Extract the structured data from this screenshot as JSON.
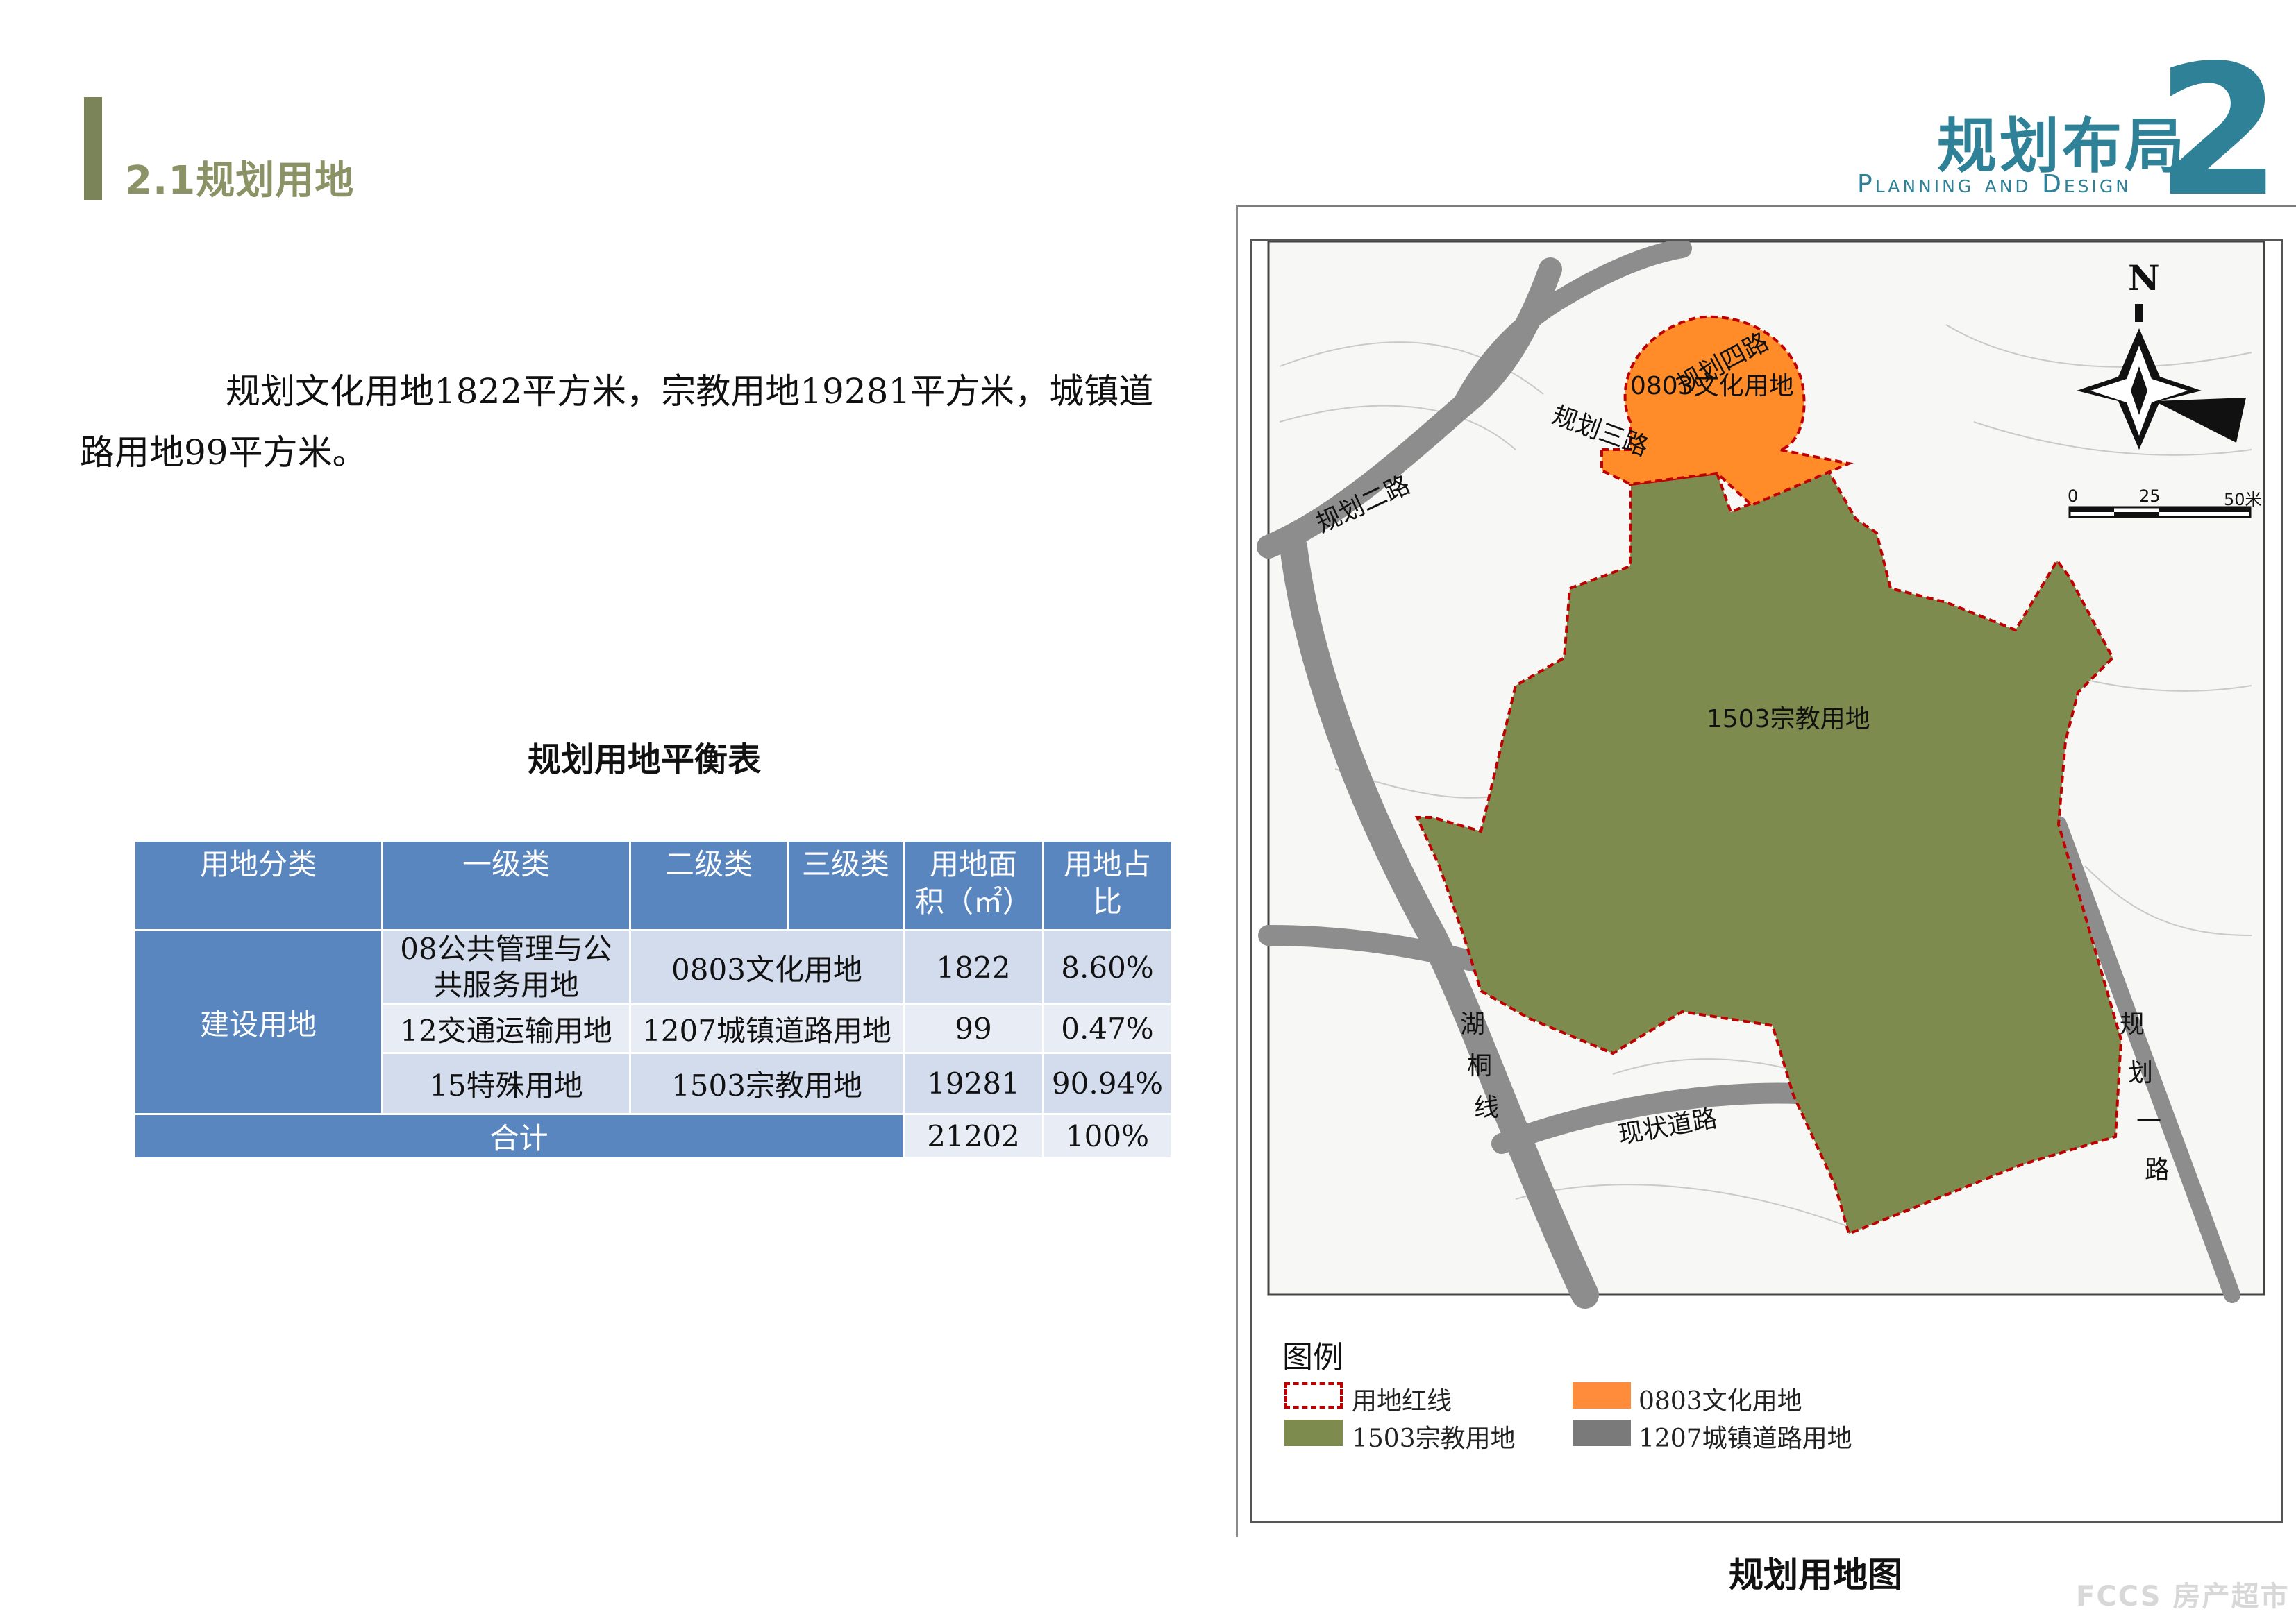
{
  "header": {
    "section_title": "2.1规划用地",
    "chapter_title": "规划布局",
    "chapter_subtitle": "Planning and Design",
    "chapter_number": "2"
  },
  "intro": {
    "line1": "规划文化用地1822平方米，宗教用地19281平方米，城镇道",
    "line2": "路用地99平方米。"
  },
  "table": {
    "title": "规划用地平衡表",
    "headers": [
      "用地分类",
      "一级类",
      "二级类",
      "三级类",
      "用地面积（㎡）",
      "用地占比"
    ],
    "header_area_line1": "用地面",
    "header_area_line2": "积（㎡）",
    "header_ratio_line1": "用地占",
    "header_ratio_line2": "比",
    "category": "建设用地",
    "rows": [
      {
        "level1": "08公共管理与公共服务用地",
        "level1_line1": "08公共管理与公",
        "level1_line2": "共服务用地",
        "level2": "0803文化用地",
        "area": "1822",
        "ratio": "8.60%"
      },
      {
        "level1": "12交通运输用地",
        "level2": "1207城镇道路用地",
        "area": "99",
        "ratio": "0.47%"
      },
      {
        "level1": "15特殊用地",
        "level2": "1503宗教用地",
        "area": "19281",
        "ratio": "90.94%"
      }
    ],
    "total_label": "合计",
    "total_area": "21202",
    "total_ratio": "100%"
  },
  "map": {
    "caption": "规划用地图",
    "labels": {
      "cultural": "0803文化用地",
      "religious": "1503宗教用地",
      "road4": "规划四路",
      "road3": "规划三路",
      "road2": "规划二路",
      "road1_a": "规",
      "road1_b": "划",
      "road1_c": "一",
      "road1_d": "路",
      "hutong_a": "湖",
      "hutong_b": "桐",
      "hutong_c": "线",
      "existing_road": "现状道路",
      "north": "N",
      "scale_0": "0",
      "scale_25": "25",
      "scale_50": "50米"
    },
    "colors": {
      "cultural": "#ff8c28",
      "religious": "#7e8b4e",
      "road": "#7a7a7a",
      "redline": "#c00000"
    }
  },
  "legend": {
    "title": "图例",
    "items": [
      {
        "label": "用地红线",
        "icon": "dashed-red-outline"
      },
      {
        "label": "0803文化用地",
        "color": "#ff8c3a"
      },
      {
        "label": "1503宗教用地",
        "color": "#7e8b4e"
      },
      {
        "label": "1207城镇道路用地",
        "color": "#7a7a7a"
      }
    ]
  },
  "watermark": "FCCS 房产超市"
}
